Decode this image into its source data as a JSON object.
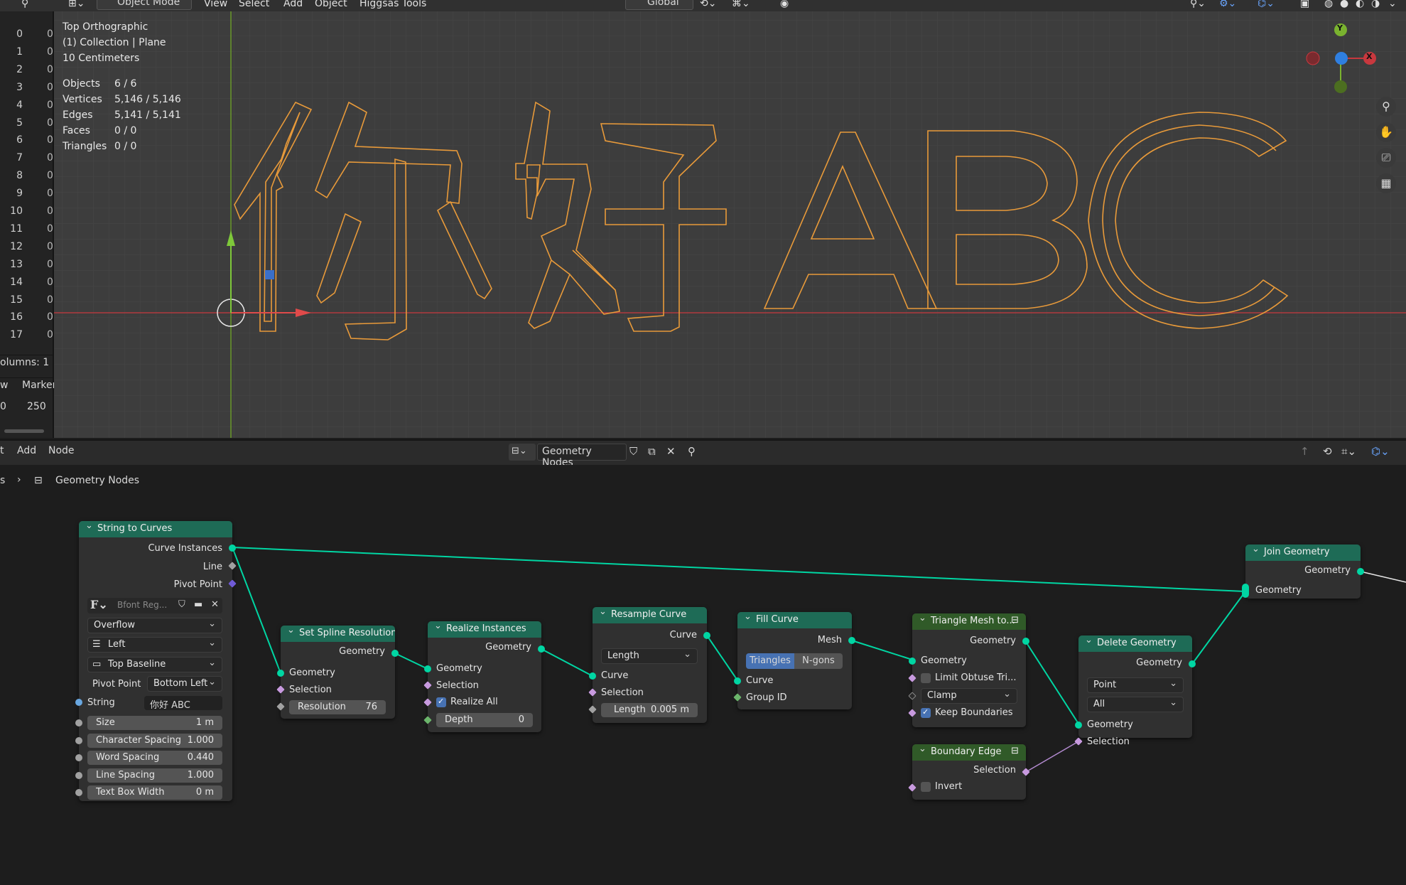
{
  "header": {
    "mode": "Object Mode",
    "menus": [
      "View",
      "Select",
      "Add",
      "Object",
      "Higgsas Tools"
    ],
    "orientation": "Global"
  },
  "spreadsheet": {
    "rows": [
      "0",
      "1",
      "2",
      "3",
      "4",
      "5",
      "6",
      "7",
      "8",
      "9",
      "10",
      "11",
      "12",
      "13",
      "14",
      "15",
      "16",
      "17"
    ],
    "col_char": "0",
    "columns_label": "olumns: 1",
    "timeline_w": "w",
    "timeline_marker": "Marker",
    "timeline_start": "0",
    "timeline_end": "250"
  },
  "viewport": {
    "view_name": "Top Orthographic",
    "collection": "(1) Collection | Plane",
    "scale": "10 Centimeters",
    "stats": [
      {
        "label": "Objects",
        "value": "6 / 6"
      },
      {
        "label": "Vertices",
        "value": "5,146 / 5,146"
      },
      {
        "label": "Edges",
        "value": "5,141 / 5,141"
      },
      {
        "label": "Faces",
        "value": "0 / 0"
      },
      {
        "label": "Triangles",
        "value": "0 / 0"
      }
    ],
    "text_3d": "你好 ABC",
    "gizmo": {
      "y": "Y",
      "x": "X"
    },
    "colors": {
      "outline": "#e89a3a",
      "x_axis": "#c8383e",
      "y_axis": "#7ab32f",
      "bg": "#3d3d3d"
    }
  },
  "node_header": {
    "menus": [
      "t",
      "Add",
      "Node"
    ],
    "tree_name": "Geometry Nodes",
    "breadcrumb_prefix": "s",
    "breadcrumb": "Geometry Nodes"
  },
  "nodes": {
    "string_to_curves": {
      "title": "String to Curves",
      "out_curve_instances": "Curve Instances",
      "out_line": "Line",
      "out_pivot": "Pivot Point",
      "font": "Bfont Reg...",
      "overflow": "Overflow",
      "align_x": "Left",
      "align_y": "Top Baseline",
      "pivot_label": "Pivot Point",
      "pivot_value": "Bottom Left",
      "string_label": "String",
      "string_value": "你好 ABC",
      "size_label": "Size",
      "size_value": "1 m",
      "char_label": "Character Spacing",
      "char_value": "1.000",
      "word_label": "Word Spacing",
      "word_value": "0.440",
      "line_label": "Line Spacing",
      "line_value": "1.000",
      "tbw_label": "Text Box Width",
      "tbw_value": "0 m"
    },
    "set_spline": {
      "title": "Set Spline Resolution",
      "out": "Geometry",
      "in_geo": "Geometry",
      "in_sel": "Selection",
      "res_label": "Resolution",
      "res_value": "76"
    },
    "realize": {
      "title": "Realize Instances",
      "out": "Geometry",
      "in_geo": "Geometry",
      "in_sel": "Selection",
      "realize_all": "Realize All",
      "depth_label": "Depth",
      "depth_value": "0"
    },
    "resample": {
      "title": "Resample Curve",
      "out": "Curve",
      "mode": "Length",
      "in_curve": "Curve",
      "in_sel": "Selection",
      "len_label": "Length",
      "len_value": "0.005 m"
    },
    "fill": {
      "title": "Fill Curve",
      "out": "Mesh",
      "mode_a": "Triangles",
      "mode_b": "N-gons",
      "in_curve": "Curve",
      "in_group": "Group ID"
    },
    "tri_mesh": {
      "title": "Triangle Mesh to...",
      "out": "Geometry",
      "in_geo": "Geometry",
      "limit": "Limit Obtuse Tri...",
      "clamp": "Clamp",
      "keep": "Keep Boundaries"
    },
    "boundary": {
      "title": "Boundary Edge",
      "out": "Selection",
      "invert": "Invert"
    },
    "delete": {
      "title": "Delete Geometry",
      "out": "Geometry",
      "domain": "Point",
      "mode": "All",
      "in_geo": "Geometry",
      "in_sel": "Selection"
    },
    "join": {
      "title": "Join Geometry",
      "out": "Geometry",
      "in_geo": "Geometry"
    }
  }
}
